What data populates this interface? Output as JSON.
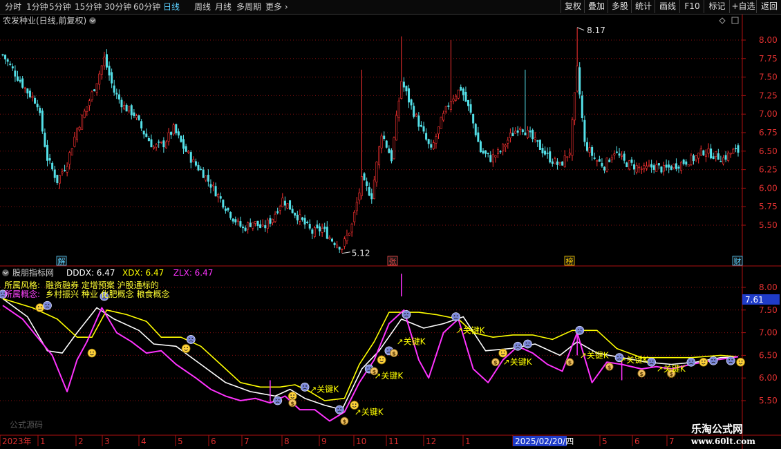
{
  "toolbar": {
    "periods": [
      "分时",
      "1分钟",
      "5分钟",
      "15分钟",
      "30分钟",
      "60分钟",
      "日线",
      "周线",
      "月线",
      "多周期",
      "更多"
    ],
    "active_period": "日线",
    "buttons": [
      "复权",
      "叠加",
      "多股",
      "统计",
      "画线",
      "F10",
      "标记",
      "+自选",
      "返回"
    ]
  },
  "upper_panel": {
    "title": "农发种业(日线,前复权)",
    "high_label": "8.17",
    "low_label": "5.12",
    "y_ticks": [
      "8.00",
      "7.75",
      "7.50",
      "7.25",
      "7.00",
      "6.75",
      "6.50",
      "6.25",
      "6.00",
      "5.75",
      "5.50"
    ],
    "markers": [
      "解",
      "张",
      "榜",
      "财"
    ]
  },
  "lower_panel": {
    "title": "股朋指标网",
    "indicators": [
      {
        "label": "DDDX: 6.47",
        "color": "#ffffff"
      },
      {
        "label": "XDX: 6.47",
        "color": "#ffff00"
      },
      {
        "label": "ZLX: 6.47",
        "color": "#ff33ff"
      }
    ],
    "style_label": "所属风格:",
    "style_value": "融资融券 定增预案 沪股通标的",
    "concept_label": "所属概念:",
    "concept_value": "乡村振兴 种业 化肥概念 粮食概念",
    "y_ticks": [
      "8.00",
      "7.50",
      "7.00",
      "6.50",
      "6.00",
      "5.50"
    ],
    "current_value": "7.61",
    "key_k_label": "关键K",
    "watermark": "公式源码"
  },
  "x_axis": {
    "labels": [
      "2023年",
      "1",
      "2",
      "3",
      "4",
      "5",
      "6",
      "7",
      "8",
      "9",
      "10",
      "11",
      "12",
      "1",
      "2025/02/20/四",
      "5",
      "6",
      "7"
    ]
  },
  "watermark": {
    "line1": "乐淘公式网",
    "line2": "www.60lt.com"
  },
  "chart_data": {
    "type": "candlestick",
    "title": "农发种业(日线,前复权)",
    "price_range": [
      5.3,
      8.17
    ],
    "high": 8.17,
    "low": 5.12,
    "close_path": [
      [
        0,
        7.8
      ],
      [
        5,
        7.55
      ],
      [
        10,
        7.3
      ],
      [
        14,
        7.15
      ],
      [
        18,
        6.4
      ],
      [
        22,
        6.1
      ],
      [
        26,
        6.35
      ],
      [
        30,
        6.8
      ],
      [
        34,
        7.1
      ],
      [
        38,
        7.45
      ],
      [
        41,
        7.75
      ],
      [
        45,
        7.3
      ],
      [
        49,
        7.1
      ],
      [
        53,
        7.0
      ],
      [
        57,
        6.75
      ],
      [
        61,
        6.55
      ],
      [
        65,
        6.6
      ],
      [
        69,
        6.8
      ],
      [
        73,
        6.55
      ],
      [
        77,
        6.35
      ],
      [
        81,
        6.2
      ],
      [
        85,
        6.0
      ],
      [
        89,
        5.8
      ],
      [
        93,
        5.6
      ],
      [
        97,
        5.45
      ],
      [
        101,
        5.55
      ],
      [
        105,
        5.45
      ],
      [
        109,
        5.6
      ],
      [
        113,
        5.85
      ],
      [
        117,
        5.7
      ],
      [
        121,
        5.55
      ],
      [
        125,
        5.4
      ],
      [
        129,
        5.45
      ],
      [
        133,
        5.3
      ],
      [
        137,
        5.2
      ],
      [
        141,
        5.5
      ],
      [
        145,
        6.1
      ],
      [
        149,
        5.9
      ],
      [
        153,
        6.75
      ],
      [
        157,
        6.4
      ],
      [
        161,
        7.45
      ],
      [
        165,
        7.1
      ],
      [
        169,
        6.8
      ],
      [
        173,
        6.5
      ],
      [
        177,
        6.9
      ],
      [
        181,
        7.2
      ],
      [
        185,
        7.35
      ],
      [
        189,
        7.0
      ],
      [
        193,
        6.5
      ],
      [
        197,
        6.4
      ],
      [
        201,
        6.5
      ],
      [
        205,
        6.7
      ],
      [
        209,
        6.85
      ],
      [
        213,
        6.7
      ],
      [
        217,
        6.55
      ],
      [
        221,
        6.4
      ],
      [
        225,
        6.3
      ],
      [
        229,
        6.5
      ],
      [
        232,
        7.6
      ],
      [
        235,
        6.6
      ],
      [
        239,
        6.4
      ],
      [
        243,
        6.3
      ],
      [
        247,
        6.5
      ],
      [
        251,
        6.35
      ],
      [
        255,
        6.3
      ],
      [
        259,
        6.25
      ],
      [
        263,
        6.3
      ],
      [
        267,
        6.25
      ],
      [
        271,
        6.3
      ],
      [
        275,
        6.35
      ],
      [
        279,
        6.4
      ],
      [
        283,
        6.5
      ],
      [
        287,
        6.45
      ],
      [
        291,
        6.4
      ],
      [
        295,
        6.5
      ]
    ],
    "spikes": [
      [
        145,
        7.6
      ],
      [
        161,
        8.05
      ],
      [
        181,
        8.0
      ],
      [
        211,
        7.6
      ],
      [
        232,
        8.17
      ]
    ],
    "lower_series": [
      {
        "name": "DDDX",
        "color": "#ffffff",
        "points": [
          [
            0,
            7.75
          ],
          [
            10,
            7.35
          ],
          [
            18,
            6.6
          ],
          [
            24,
            6.55
          ],
          [
            30,
            7.0
          ],
          [
            38,
            7.55
          ],
          [
            45,
            7.3
          ],
          [
            55,
            7.05
          ],
          [
            61,
            6.75
          ],
          [
            70,
            6.7
          ],
          [
            80,
            6.3
          ],
          [
            90,
            5.9
          ],
          [
            100,
            5.7
          ],
          [
            110,
            5.6
          ],
          [
            116,
            5.75
          ],
          [
            122,
            5.55
          ],
          [
            130,
            5.4
          ],
          [
            137,
            5.3
          ],
          [
            145,
            6.2
          ],
          [
            152,
            6.6
          ],
          [
            161,
            7.3
          ],
          [
            170,
            7.1
          ],
          [
            178,
            7.2
          ],
          [
            186,
            7.35
          ],
          [
            195,
            6.6
          ],
          [
            205,
            6.65
          ],
          [
            215,
            6.75
          ],
          [
            225,
            6.5
          ],
          [
            232,
            6.8
          ],
          [
            240,
            6.55
          ],
          [
            250,
            6.45
          ],
          [
            260,
            6.35
          ],
          [
            270,
            6.3
          ],
          [
            280,
            6.35
          ],
          [
            290,
            6.45
          ],
          [
            297,
            6.47
          ]
        ]
      },
      {
        "name": "XDX",
        "color": "#ffff00",
        "points": [
          [
            0,
            7.75
          ],
          [
            12,
            7.55
          ],
          [
            22,
            7.3
          ],
          [
            30,
            6.9
          ],
          [
            36,
            6.9
          ],
          [
            42,
            7.5
          ],
          [
            50,
            7.4
          ],
          [
            58,
            7.25
          ],
          [
            64,
            6.9
          ],
          [
            72,
            6.9
          ],
          [
            80,
            6.7
          ],
          [
            88,
            6.3
          ],
          [
            96,
            5.9
          ],
          [
            104,
            5.8
          ],
          [
            112,
            5.8
          ],
          [
            118,
            5.85
          ],
          [
            124,
            5.7
          ],
          [
            130,
            5.5
          ],
          [
            138,
            5.55
          ],
          [
            144,
            6.3
          ],
          [
            150,
            6.8
          ],
          [
            156,
            7.45
          ],
          [
            168,
            7.45
          ],
          [
            175,
            7.4
          ],
          [
            184,
            7.3
          ],
          [
            190,
            7.0
          ],
          [
            198,
            6.9
          ],
          [
            206,
            6.95
          ],
          [
            214,
            6.95
          ],
          [
            222,
            6.85
          ],
          [
            230,
            7.05
          ],
          [
            240,
            7.05
          ],
          [
            248,
            6.65
          ],
          [
            258,
            6.45
          ],
          [
            268,
            6.45
          ],
          [
            278,
            6.45
          ],
          [
            290,
            6.5
          ],
          [
            297,
            6.47
          ]
        ]
      },
      {
        "name": "ZLX",
        "color": "#ff33ff",
        "points": [
          [
            0,
            7.6
          ],
          [
            8,
            7.3
          ],
          [
            14,
            6.9
          ],
          [
            20,
            6.5
          ],
          [
            26,
            5.7
          ],
          [
            30,
            6.4
          ],
          [
            34,
            6.8
          ],
          [
            40,
            7.55
          ],
          [
            46,
            7.0
          ],
          [
            52,
            6.8
          ],
          [
            58,
            6.55
          ],
          [
            64,
            6.6
          ],
          [
            70,
            6.3
          ],
          [
            78,
            6.0
          ],
          [
            84,
            5.75
          ],
          [
            90,
            5.6
          ],
          [
            96,
            5.5
          ],
          [
            102,
            5.55
          ],
          [
            108,
            5.45
          ],
          [
            114,
            5.6
          ],
          [
            120,
            5.3
          ],
          [
            126,
            5.3
          ],
          [
            132,
            5.05
          ],
          [
            138,
            5.25
          ],
          [
            144,
            5.9
          ],
          [
            150,
            6.4
          ],
          [
            156,
            7.2
          ],
          [
            162,
            7.5
          ],
          [
            168,
            6.4
          ],
          [
            172,
            6.0
          ],
          [
            178,
            7.0
          ],
          [
            184,
            7.3
          ],
          [
            190,
            6.2
          ],
          [
            196,
            5.9
          ],
          [
            202,
            6.4
          ],
          [
            208,
            6.7
          ],
          [
            214,
            6.55
          ],
          [
            220,
            6.3
          ],
          [
            226,
            6.15
          ],
          [
            232,
            7.0
          ],
          [
            238,
            5.9
          ],
          [
            244,
            6.35
          ],
          [
            250,
            6.3
          ],
          [
            258,
            6.2
          ],
          [
            264,
            6.25
          ],
          [
            270,
            6.2
          ],
          [
            278,
            6.3
          ],
          [
            288,
            6.4
          ],
          [
            297,
            6.47
          ]
        ]
      }
    ]
  }
}
